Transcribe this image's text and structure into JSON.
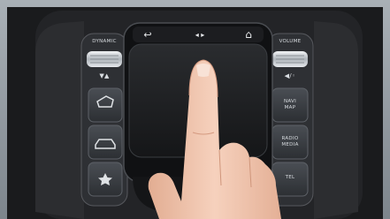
{
  "console": {
    "left_panel": {
      "top_label": "DYNAMIC",
      "arrows": "▼▲",
      "icons": [
        "parking-assist-icon",
        "car-icon",
        "star-favorite-icon"
      ]
    },
    "touchpad": {
      "back_glyph": "↩",
      "media_glyph": "◂ ▸",
      "home_glyph": "⌂"
    },
    "right_panel": {
      "top_label": "VOLUME",
      "mute_glyph": "◀/◦",
      "buttons": [
        {
          "line1": "NAVI",
          "line2": "MAP"
        },
        {
          "line1": "RADIO",
          "line2": "MEDIA"
        },
        {
          "line1": "TEL",
          "line2": ""
        }
      ]
    }
  },
  "colors": {
    "console_dark": "#1a1b1d",
    "button_face": "#3a3d42",
    "chrome": "#c9ced3",
    "skin": "#f0c6ae"
  }
}
